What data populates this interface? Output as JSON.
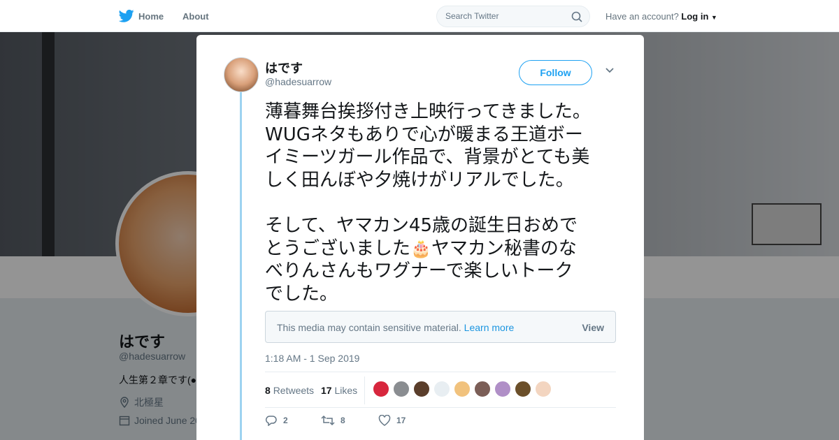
{
  "nav": {
    "home_label": "Home",
    "about_label": "About",
    "search_placeholder": "Search Twitter",
    "account_prompt": "Have an account?",
    "login_label": "Log in"
  },
  "profile": {
    "name": "はです",
    "handle": "@hadesuarrow",
    "bio": "人生第２章です(●",
    "location": "北極星",
    "joined": "Joined June 20"
  },
  "tweet": {
    "name": "はです",
    "handle": "@hadesuarrow",
    "follow_label": "Follow",
    "text_part1": "薄暮舞台挨拶付き上映行ってきました。\nWUGネタもありで心が暖まる王道ボー\nイミーツガール作品で、背景がとても美\nしく田んぼや夕焼けがリアルでした。\n\nそして、ヤマカン45歳の誕生日おめで\nとうございました",
    "text_emoji": "🎂",
    "text_part2": "ヤマカン秘書のな\nべりんさんもワグナーで楽しいトーク\nでした。",
    "sensitive_message": "This media may contain sensitive material.",
    "learn_more": "Learn more",
    "view_label": "View",
    "timestamp": "1:18 AM - 1 Sep 2019",
    "retweets_count": "8",
    "retweets_label": "Retweets",
    "likes_count": "17",
    "likes_label": "Likes",
    "reply_count": "2",
    "retweet_action_count": "8",
    "like_action_count": "17"
  },
  "colors": {
    "accent": "#1da1f2",
    "thread_line": "#9dd3f1",
    "liker_colors": [
      "#d7263d",
      "#8a8d91",
      "#5a3e2b",
      "#e8eef2",
      "#f1c27d",
      "#7b5e57",
      "#b08fc7",
      "#6b4f2a",
      "#f3d5c0"
    ]
  },
  "icons": {
    "logo": "twitter-bird-icon",
    "search": "search-icon",
    "close": "close-icon",
    "caret": "chevron-down-icon",
    "location": "location-pin-icon",
    "calendar": "calendar-icon",
    "reply": "reply-icon",
    "retweet": "retweet-icon",
    "like": "heart-icon"
  }
}
